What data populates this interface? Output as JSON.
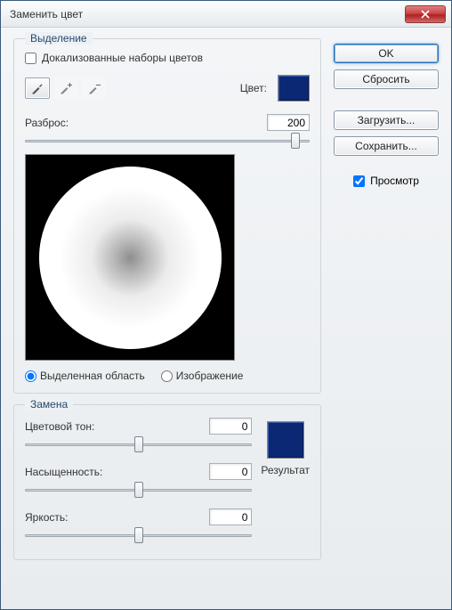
{
  "window": {
    "title": "Заменить цвет"
  },
  "buttons": {
    "ok": "OK",
    "reset": "Сбросить",
    "load": "Загрузить...",
    "save": "Сохранить..."
  },
  "preview_chk": {
    "label": "Просмотр",
    "checked": true
  },
  "selection": {
    "legend": "Выделение",
    "localized_sets": {
      "label": "Докализованные наборы цветов",
      "checked": false
    },
    "color_label": "Цвет:",
    "color_hex": "#0a2874",
    "fuzziness": {
      "label": "Разброс:",
      "value": "200",
      "pos_pct": 95
    },
    "view": {
      "selection_label": "Выделенная область",
      "image_label": "Изображение",
      "selected": "selection"
    }
  },
  "replacement": {
    "legend": "Замена",
    "hue": {
      "label": "Цветовой тон:",
      "value": "0",
      "pos_pct": 50
    },
    "sat": {
      "label": "Насыщенность:",
      "value": "0",
      "pos_pct": 50
    },
    "lig": {
      "label": "Яркость:",
      "value": "0",
      "pos_pct": 50
    },
    "result_label": "Результат",
    "result_hex": "#0a2874"
  }
}
